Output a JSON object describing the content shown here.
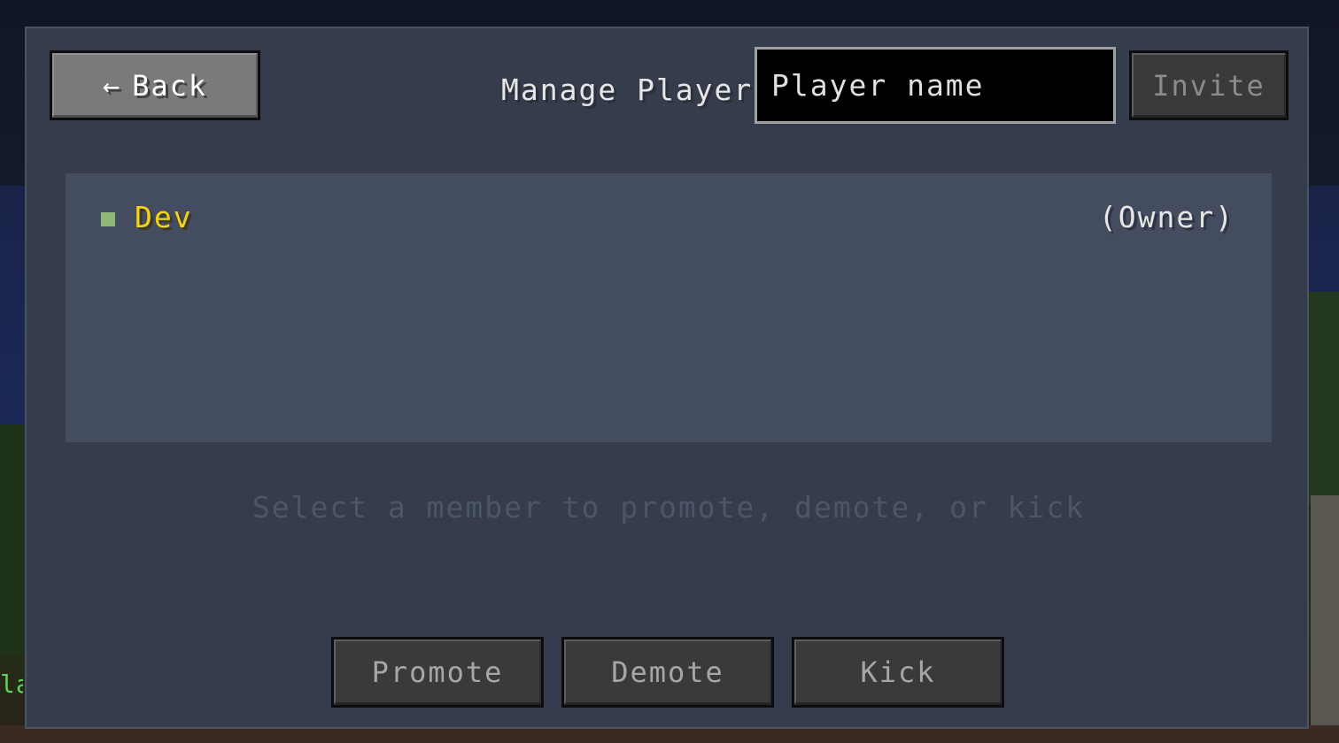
{
  "background": {
    "hud_text": "la"
  },
  "header": {
    "back_label": "Back",
    "back_icon": "left-arrow-icon",
    "title": "Manage Player",
    "search": {
      "placeholder": "Player name",
      "value": ""
    },
    "invite_label": "Invite"
  },
  "members": [
    {
      "name": "Dev",
      "role": "(Owner)",
      "name_color": "#f2d21a",
      "status_color": "#8fb77a"
    }
  ],
  "hint": "Select a member to promote, demote, or kick",
  "actions": {
    "promote_label": "Promote",
    "demote_label": "Demote",
    "kick_label": "Kick"
  },
  "colors": {
    "panel": "#353d4d",
    "list": "#444d5f",
    "button_disabled": "#3a3a3a",
    "button_active": "#7a7a7a"
  }
}
